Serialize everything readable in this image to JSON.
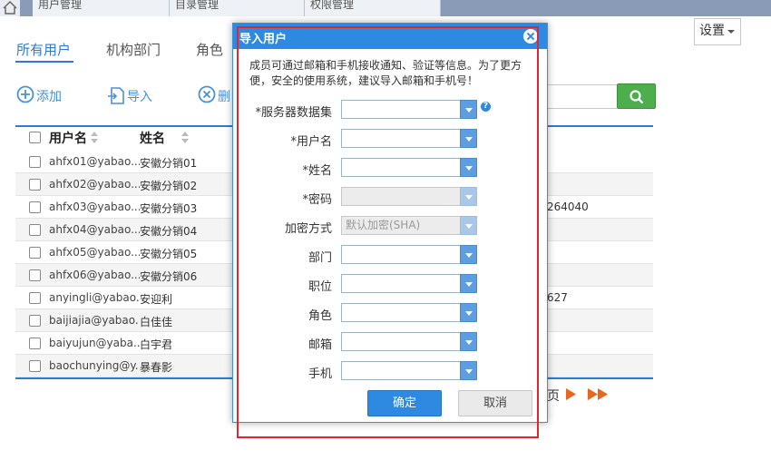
{
  "top_tabs": [
    {
      "label": "用户管理"
    },
    {
      "label": "目录管理"
    },
    {
      "label": "权限管理"
    }
  ],
  "settings_label": "设置",
  "sub_tabs": [
    {
      "label": "所有用户"
    },
    {
      "label": "机构部门"
    },
    {
      "label": "角色"
    }
  ],
  "toolbar": {
    "add_label": "添加",
    "import_label": "导入",
    "delete_label": "删"
  },
  "table": {
    "columns": [
      "用户名",
      "姓名"
    ],
    "rows": [
      {
        "username": "ahfx01@yabao....",
        "name": "安徽分销01",
        "extra": ""
      },
      {
        "username": "ahfx02@yabao....",
        "name": "安徽分销02",
        "extra": ""
      },
      {
        "username": "ahfx03@yabao....",
        "name": "安徽分销03",
        "extra": "264040"
      },
      {
        "username": "ahfx04@yabao....",
        "name": "安徽分销04",
        "extra": ""
      },
      {
        "username": "ahfx05@yabao....",
        "name": "安徽分销05",
        "extra": ""
      },
      {
        "username": "ahfx06@yabao....",
        "name": "安徽分销06",
        "extra": ""
      },
      {
        "username": "anyingli@yabao...",
        "name": "安迎利",
        "extra": "627"
      },
      {
        "username": "baijiajia@yabao...",
        "name": "白佳佳",
        "extra": ""
      },
      {
        "username": "baiyujun@yaba...",
        "name": "白宇君",
        "extra": ""
      },
      {
        "username": "baochunying@y...",
        "name": "暴春影",
        "extra": ""
      }
    ]
  },
  "pager": {
    "label": "页"
  },
  "modal": {
    "title": "导入用户",
    "notice": "成员可通过邮箱和手机接收通知、验证等信息。为了更方便，安全的使用系统，建议导入邮箱和手机号！",
    "fields": [
      {
        "label": "*服务器数据集",
        "value": ""
      },
      {
        "label": "*用户名",
        "value": ""
      },
      {
        "label": "*姓名",
        "value": ""
      },
      {
        "label": "*密码",
        "value": ""
      },
      {
        "label": "加密方式",
        "value": "默认加密(SHA)"
      },
      {
        "label": "部门",
        "value": ""
      },
      {
        "label": "职位",
        "value": ""
      },
      {
        "label": "角色",
        "value": ""
      },
      {
        "label": "邮箱",
        "value": ""
      },
      {
        "label": "手机",
        "value": ""
      }
    ],
    "help_glyph": "?",
    "ok_label": "确定",
    "cancel_label": "取消"
  },
  "colors": {
    "accent": "#2e8ae0",
    "search_button": "#4cae4c",
    "highlight": "#e3262b",
    "pager_arrows": "#e8661e"
  }
}
